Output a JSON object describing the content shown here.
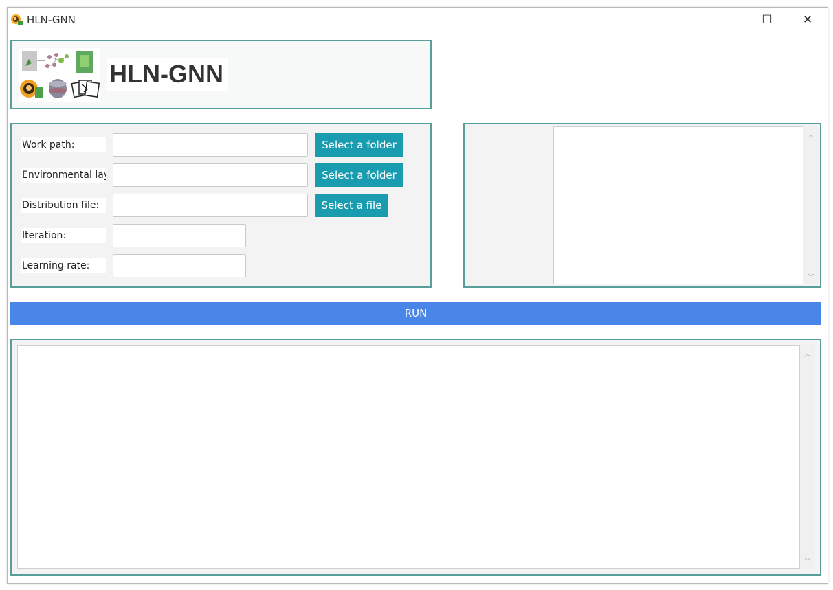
{
  "window": {
    "title": "HLN-GNN",
    "minimize_glyph": "—",
    "maximize_glyph": "☐",
    "close_glyph": "✕"
  },
  "header": {
    "title": "HLN-GNN"
  },
  "form": {
    "work_path": {
      "label": "Work path:",
      "value": "",
      "button": "Select a folder"
    },
    "env_layer": {
      "label": "Environmental layer:",
      "value": "",
      "button": "Select a folder"
    },
    "distribution": {
      "label": "Distribution file:",
      "value": "",
      "button": "Select a file"
    },
    "iteration": {
      "label": "Iteration:",
      "value": ""
    },
    "learning_rate": {
      "label": "Learning rate:",
      "value": ""
    }
  },
  "run_button": {
    "label": "RUN"
  },
  "preview": {
    "content": ""
  },
  "log": {
    "content": ""
  },
  "scroll": {
    "up": "︿",
    "down": "﹀"
  },
  "colors": {
    "panel_border": "#5a9e9a",
    "button": "#1a9cb0",
    "run": "#4a86e8"
  }
}
